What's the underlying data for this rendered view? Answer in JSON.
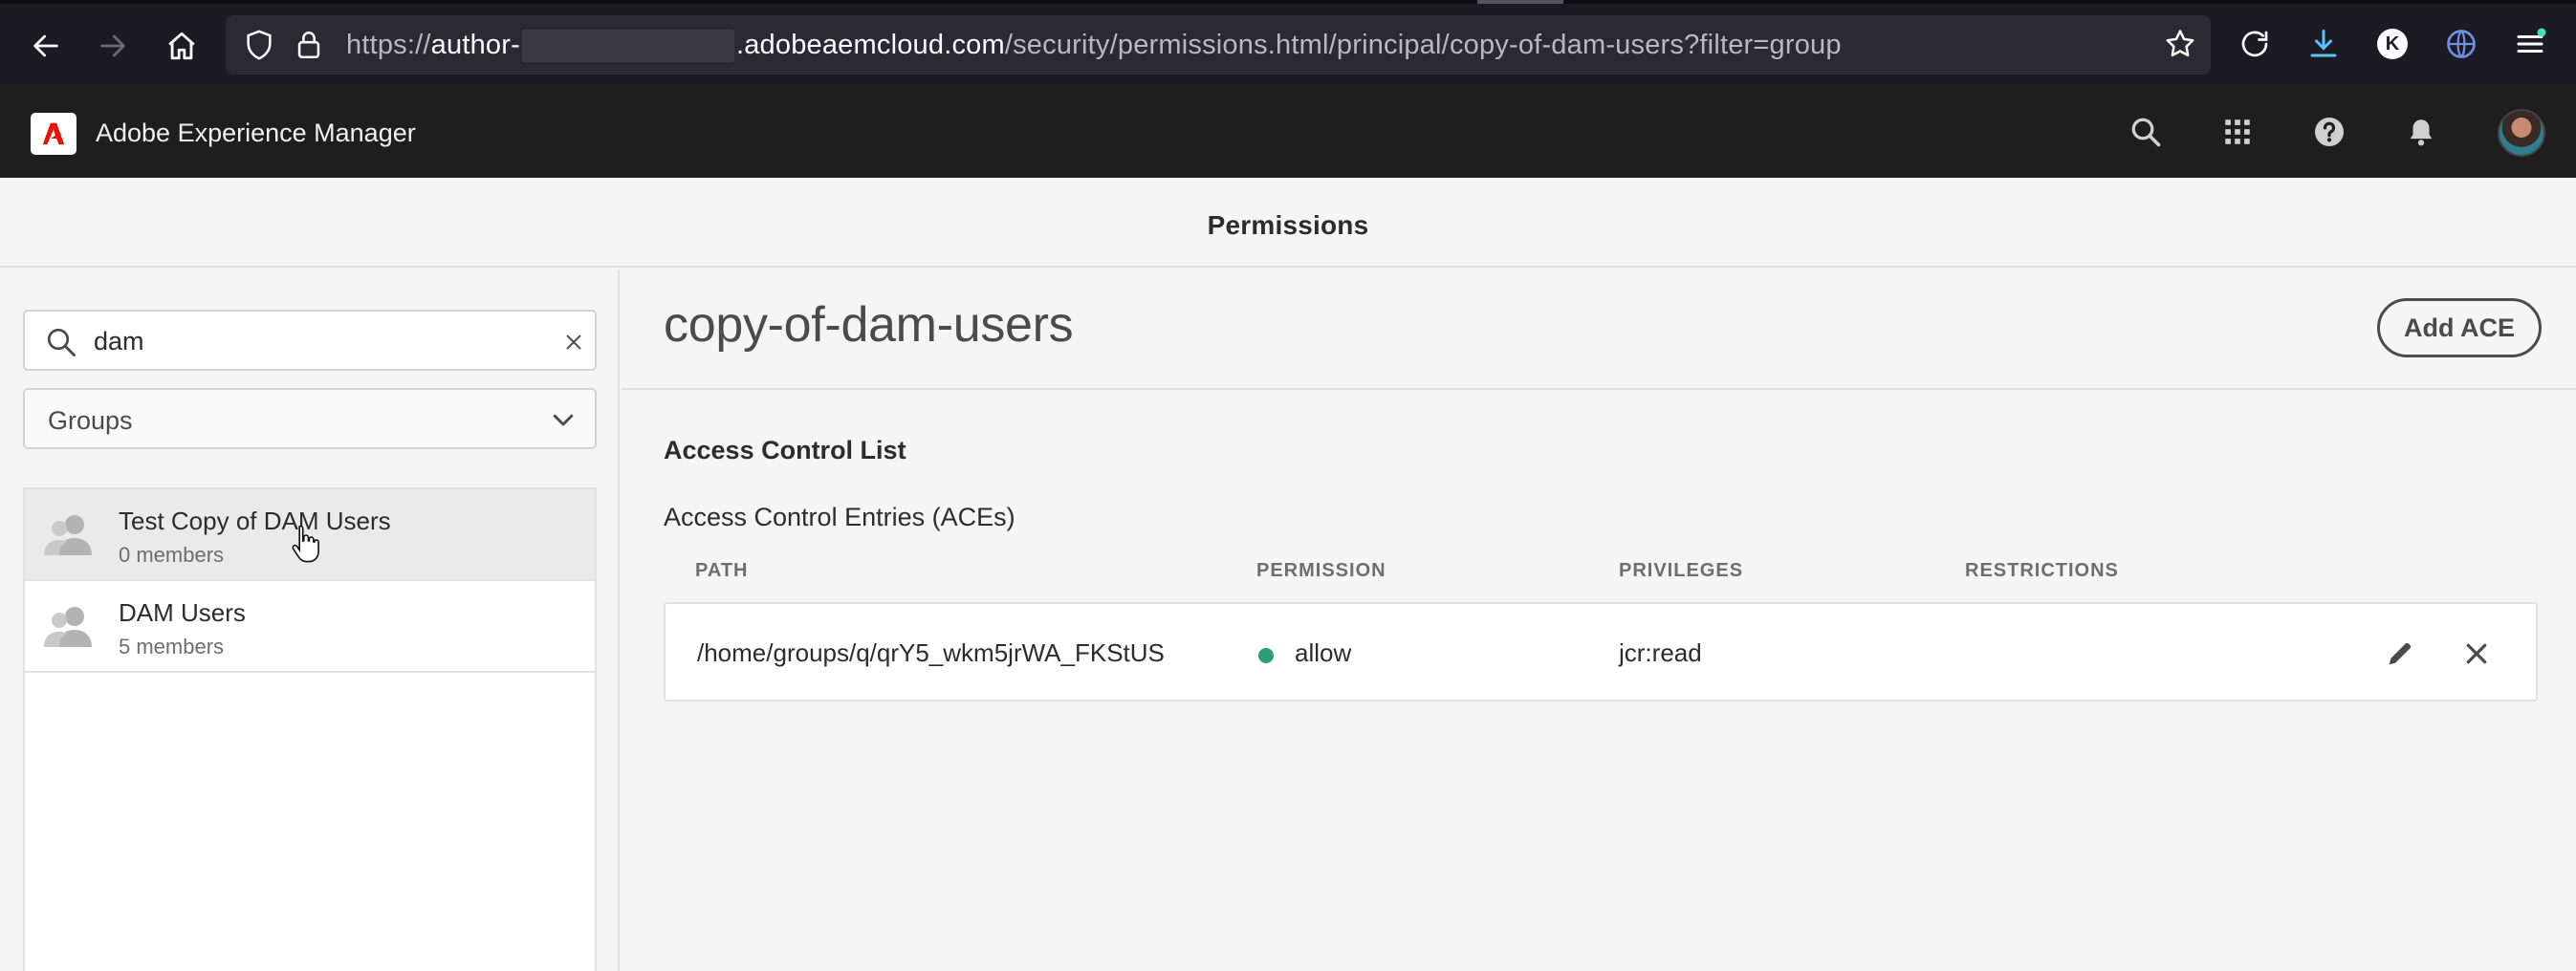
{
  "browser": {
    "url_prefix": "https://",
    "url_host_start": "author-",
    "url_host_end": ".adobeaemcloud.com",
    "url_path": "/security/permissions.html/principal/copy-of-dam-users?filter=group",
    "profile_initial": "K",
    "icons": [
      "back-icon",
      "forward-icon",
      "home-icon",
      "shield-icon",
      "lock-icon",
      "bookmark-star-icon",
      "reload-icon",
      "download-icon",
      "profile-icon",
      "globe-icon",
      "menu-icon"
    ]
  },
  "shell": {
    "app_name": "Adobe Experience Manager",
    "icons": [
      "search-icon",
      "apps-grid-icon",
      "help-icon",
      "notifications-icon",
      "avatar"
    ]
  },
  "page": {
    "title": "Permissions"
  },
  "rail": {
    "search_value": "dam",
    "filter_selected": "Groups",
    "items": [
      {
        "name": "Test Copy of DAM Users",
        "count": "0 members"
      },
      {
        "name": "DAM Users",
        "count": "5 members"
      }
    ]
  },
  "main": {
    "principal": "copy-of-dam-users",
    "add_button": "Add ACE",
    "acl_heading": "Access Control List",
    "ace_heading": "Access Control Entries (ACEs)",
    "columns": {
      "path": "PATH",
      "permission": "PERMISSION",
      "privileges": "PRIVILEGES",
      "restrictions": "RESTRICTIONS"
    },
    "entries": [
      {
        "path": "/home/groups/q/qrY5_wkm5jrWA_FKStUS",
        "permission": "allow",
        "privileges": "jcr:read",
        "restrictions": ""
      }
    ]
  },
  "colors": {
    "allow_dot": "#2d9d78",
    "shell_bg": "#1e1e1e",
    "browser_bg": "#1c1b22",
    "adobe_red": "#eb1000",
    "download_blue": "#5ac3ff"
  }
}
